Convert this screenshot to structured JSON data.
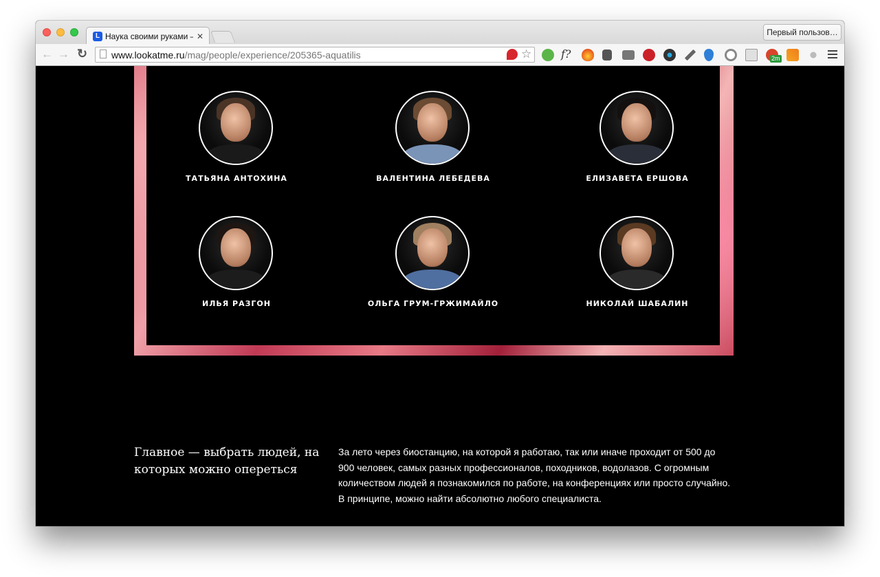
{
  "browser": {
    "tab_title": "Наука своими руками — Lo",
    "tab_close": "✕",
    "profile_button": "Первый пользов…",
    "url_host": "www.lookatme.ru",
    "url_path": "/mag/people/experience/205365-aquatilis",
    "nav": {
      "back": "←",
      "forward": "→",
      "reload": "↻",
      "star": "☆"
    },
    "favicon_letter": "L",
    "extensions": [
      "ghostery-icon",
      "evernote-web-icon",
      "fontface-icon",
      "fire-icon",
      "evernote-icon",
      "pocket-icon",
      "pinterest-icon",
      "colorzilla-icon",
      "eyedropper-icon",
      "buffer-icon",
      "refresh-ext-icon",
      "reader-icon",
      "rss-icon",
      "badge-2m-icon",
      "analytics-icon",
      "paw-icon"
    ],
    "extension_labels": {
      "fontface": "f?",
      "badge": "2m"
    }
  },
  "colors": {
    "page_background": "#000000",
    "frame_accent": "#d4566a",
    "text": "#ffffff"
  },
  "people": [
    {
      "name": "ТАТЬЯНА АНТОХИНА"
    },
    {
      "name": "ВАЛЕНТИНА ЛЕБЕДЕВА"
    },
    {
      "name": "ЕЛИЗАВЕТА ЕРШОВА"
    },
    {
      "name": "ИЛЬЯ РАЗГОН"
    },
    {
      "name": "ОЛЬГА ГРУМ-ГРЖИМАЙЛО"
    },
    {
      "name": "НИКОЛАЙ ШАБАЛИН"
    }
  ],
  "article": {
    "pull_quote": "Главное — выбрать людей, на которых можно опереться",
    "paragraph": "За лето через биостанцию, на которой я работаю, так или иначе проходит от 500 до 900 человек, самых разных профессионалов, походников, водолазов. С огромным количеством людей я познакомился по работе, на конференциях или просто случайно. В принципе, можно найти абсолютно любого специалиста."
  }
}
